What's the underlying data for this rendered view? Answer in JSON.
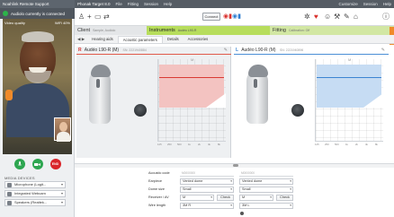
{
  "remote": {
    "title": "Noahlink Remote Support",
    "status": "Audiolo currently is connected",
    "quality_left": "Video quality",
    "quality_right": "WiFi 40%",
    "call_buttons": {
      "mic": "",
      "cam": "",
      "end": "END"
    },
    "media_label": "MEDIA DEVICES",
    "devices": [
      "Microphone (Logit...",
      "Integrated Webcam",
      "Speakers (Realtek..."
    ]
  },
  "menubar": {
    "app": "Phonak Target 8.0",
    "items": [
      "File",
      "Fitting",
      "Session",
      "Help"
    ],
    "right": [
      "Customize",
      "Session",
      "Help"
    ]
  },
  "toolbar": {
    "connect": "Connect"
  },
  "header": {
    "client": "Client",
    "client_sub": "Sample, Audiolo",
    "instruments": "Instruments",
    "instruments_sub": "Audéo L90-R",
    "fitting": "Fitting",
    "fitting_sub": "Calibration: Off"
  },
  "tabs": {
    "nav": "◀ ▶",
    "items": [
      "Hearing aids",
      "Acoustic parameters",
      "Details",
      "Accessories"
    ],
    "active": 1
  },
  "left_device": {
    "side": "R",
    "name": "Audéo L90-R (M)",
    "serial": "SN: 2221940884",
    "edit": "✎",
    "marker": "M",
    "ticks": [
      "125",
      "250",
      "500",
      "1k",
      "2k",
      "4k",
      "8k"
    ]
  },
  "right_device": {
    "side": "L",
    "name": "Audéo L90-R (M)",
    "serial": "SN: 2221940896",
    "edit": "✎",
    "marker": "M",
    "ticks": [
      "125",
      "250",
      "500",
      "1k",
      "2k",
      "4k",
      "8k"
    ]
  },
  "settings": {
    "acoustic_code": {
      "label": "Acoustic code",
      "left": "M0000000",
      "right": "M0000000"
    },
    "earpiece": {
      "label": "Earpiece",
      "left": "Vented dome",
      "right": "Vented dome"
    },
    "dome_size": {
      "label": "Dome size",
      "left": "Small",
      "right": "Small"
    },
    "receiver": {
      "label": "Receiver / AV",
      "left": "M",
      "right": "M",
      "check": "Check"
    },
    "wire_length": {
      "label": "Wire length",
      "left": "3M R",
      "right": "3M L"
    }
  }
}
